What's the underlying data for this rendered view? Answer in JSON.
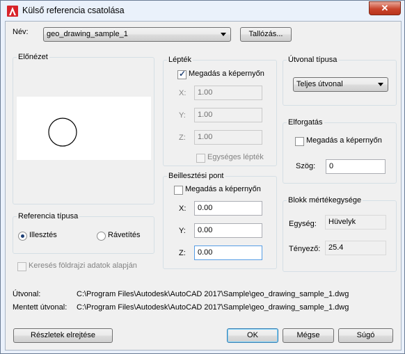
{
  "window": {
    "title": "Külső referencia csatolása",
    "close_glyph": "✕"
  },
  "top": {
    "name_label": "Név:",
    "name_value": "geo_drawing_sample_1",
    "browse_button": "Tallózás..."
  },
  "preview": {
    "title": "Előnézet"
  },
  "ref_type": {
    "title": "Referencia típusa",
    "attach_label": "Illesztés",
    "overlay_label": "Rávetítés",
    "selected": "attach"
  },
  "geo_search": {
    "label": "Keresés földrajzi adatok alapján"
  },
  "scale": {
    "title": "Lépték",
    "specify_on_screen": "Megadás a képernyőn",
    "specify_checked": true,
    "x_label": "X:",
    "x_value": "1.00",
    "y_label": "Y:",
    "y_value": "1.00",
    "z_label": "Z:",
    "z_value": "1.00",
    "uniform_label": "Egységes lépték"
  },
  "insertion": {
    "title": "Beillesztési pont",
    "specify_on_screen": "Megadás a képernyőn",
    "x_label": "X:",
    "x_value": "0.00",
    "y_label": "Y:",
    "y_value": "0.00",
    "z_label": "Z:",
    "z_value": "0.00"
  },
  "path_type": {
    "title": "Útvonal típusa",
    "selected": "Teljes útvonal"
  },
  "rotation": {
    "title": "Elforgatás",
    "specify_on_screen": "Megadás a képernyőn",
    "angle_label": "Szög:",
    "angle_value": "0"
  },
  "block_unit": {
    "title": "Blokk mértékegysége",
    "unit_label": "Egység:",
    "unit_value": "Hüvelyk",
    "factor_label": "Tényező:",
    "factor_value": "25.4"
  },
  "paths": {
    "path_label": "Útvonal:",
    "path_value": "C:\\Program Files\\Autodesk\\AutoCAD 2017\\Sample\\geo_drawing_sample_1.dwg",
    "saved_label": "Mentett útvonal:",
    "saved_value": "C:\\Program Files\\Autodesk\\AutoCAD 2017\\Sample\\geo_drawing_sample_1.dwg"
  },
  "buttons": {
    "hide_details": "Részletek elrejtése",
    "ok": "OK",
    "cancel": "Mégse",
    "help": "Súgó"
  },
  "colors": {
    "accent": "#1d3f75",
    "default_button_border": "#3c7fb1",
    "app_icon_red": "#d8232a"
  }
}
